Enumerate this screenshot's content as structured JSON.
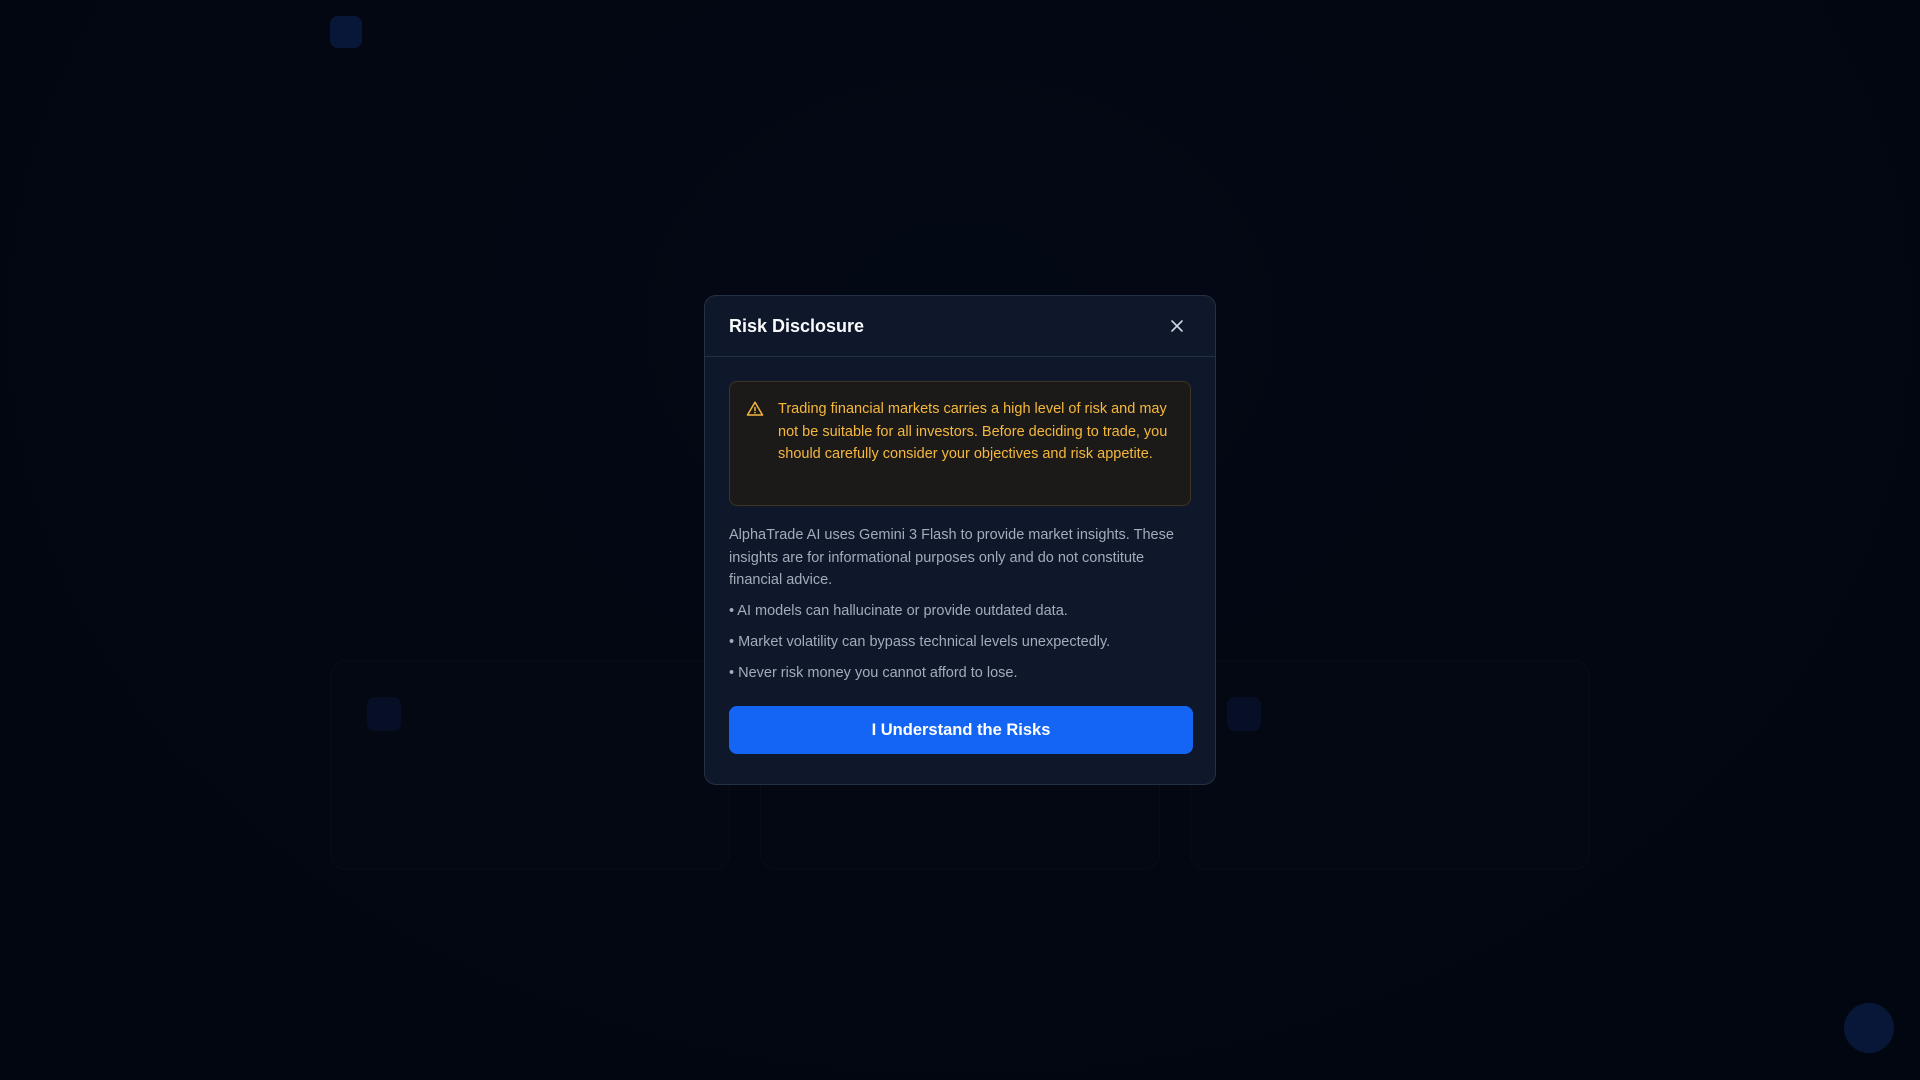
{
  "modal": {
    "title": "Risk Disclosure",
    "warning": "Trading financial markets carries a high level of risk and may not be suitable for all investors. Before deciding to trade, you should carefully consider your objectives and risk appetite.",
    "intro": "AlphaTrade AI uses Gemini 3 Flash to provide market insights. These insights are for informational purposes only and do not constitute financial advice.",
    "bullets": [
      "• AI models can hallucinate or provide outdated data.",
      "• Market volatility can bypass technical levels unexpectedly.",
      "• Never risk money you cannot afford to lose."
    ],
    "cta_label": "I Understand the Risks",
    "icons": {
      "close": "close-icon",
      "warning": "warning-triangle-icon"
    }
  },
  "colors": {
    "accent": "#1565f5",
    "warning_text": "#f5b83d",
    "modal_bg": "#0f172a",
    "page_bg": "#040914"
  }
}
